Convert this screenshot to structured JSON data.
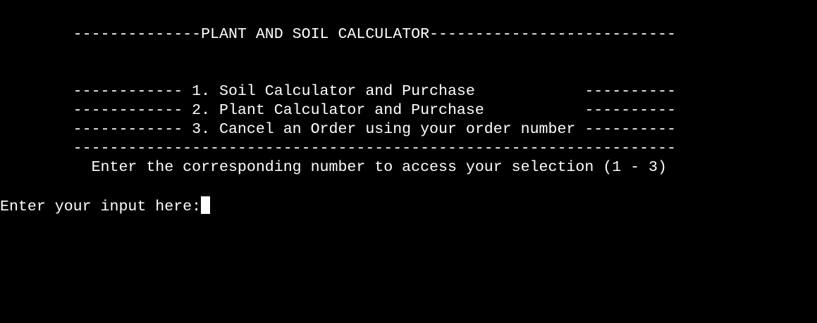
{
  "terminal": {
    "background": "#000000",
    "foreground": "#ffffff",
    "title_line": "        --------------PLANT AND SOIL CALCULATOR---------------------------",
    "menu": [
      {
        "text": "        ------------ 1. Soil Calculator and Purchase            ----------"
      },
      {
        "text": "        ------------ 2. Plant Calculator and Purchase           ----------"
      },
      {
        "text": "        ------------ 3. Cancel an Order using your order number ----------"
      }
    ],
    "rule_line": "        ------------------------------------------------------------------",
    "instruction_line": "          Enter the corresponding number to access your selection (1 - 3)",
    "input_prompt": "Enter your input here:",
    "input_value": ""
  }
}
